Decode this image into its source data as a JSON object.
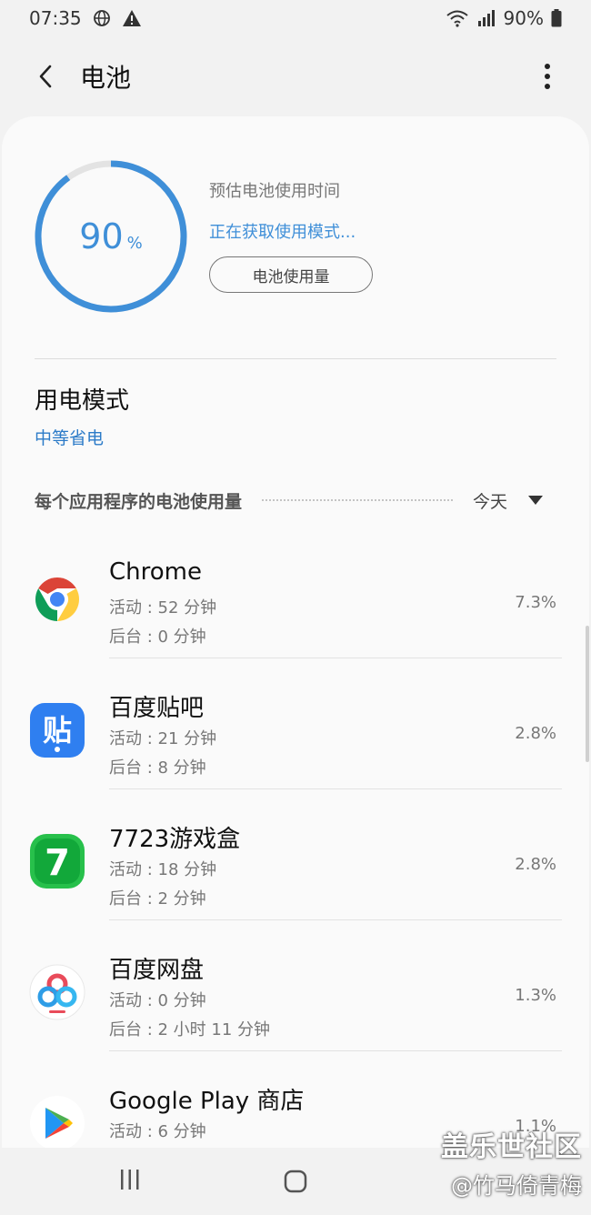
{
  "status_bar": {
    "time": "07:35",
    "battery_text": "90%"
  },
  "app_bar": {
    "title": "电池"
  },
  "summary": {
    "percent_value": "90",
    "percent_unit": "%",
    "battery_level_fraction": 0.9,
    "estimate_label": "预估电池使用时间",
    "estimate_status": "正在获取使用模式...",
    "usage_button": "电池使用量"
  },
  "power_mode": {
    "title": "用电模式",
    "value": "中等省电"
  },
  "apps_header": {
    "label": "每个应用程序的电池使用量",
    "period": "今天"
  },
  "apps": [
    {
      "name": "Chrome",
      "active": "活动 : 52 分钟",
      "background": "后台 : 0 分钟",
      "percent": "7.3%",
      "icon": "chrome-icon"
    },
    {
      "name": "百度贴吧",
      "active": "活动 : 21 分钟",
      "background": "后台 : 8 分钟",
      "percent": "2.8%",
      "icon": "tieba-icon",
      "icon_text": "贴"
    },
    {
      "name": "7723游戏盒",
      "active": "活动 : 18 分钟",
      "background": "后台 : 2 分钟",
      "percent": "2.8%",
      "icon": "game-box-icon",
      "icon_text": "7"
    },
    {
      "name": "百度网盘",
      "active": "活动 : 0 分钟",
      "background": "后台 : 2 小时 11 分钟",
      "percent": "1.3%",
      "icon": "baidu-netdisk-icon"
    },
    {
      "name": "Google Play 商店",
      "active": "活动 : 6 分钟",
      "background": "",
      "percent": "1.1%",
      "icon": "google-play-icon"
    }
  ],
  "watermark": {
    "line1": "盖乐世社区",
    "line2": "@竹马倚青梅"
  },
  "colors": {
    "accent": "#3f8fd8",
    "ring_track": "#e3e3e3",
    "link": "#2c7bc8"
  }
}
